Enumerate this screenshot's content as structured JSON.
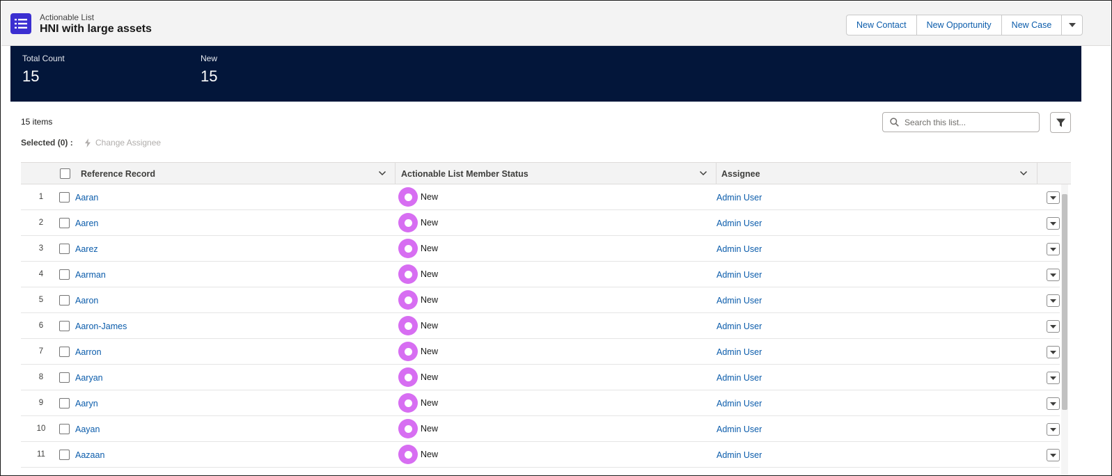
{
  "header": {
    "subtitle": "Actionable List",
    "title": "HNI with large assets",
    "actions": [
      "New Contact",
      "New Opportunity",
      "New Case"
    ]
  },
  "summary": {
    "total_label": "Total Count",
    "total_value": "15",
    "new_label": "New",
    "new_value": "15"
  },
  "toolbar": {
    "items_count": "15 items",
    "selected": "Selected (0) :",
    "change_assignee": "Change Assignee",
    "search_placeholder": "Search this list..."
  },
  "table": {
    "columns": [
      "Reference Record",
      "Actionable List Member Status",
      "Assignee"
    ],
    "rows": [
      {
        "num": "1",
        "ref": "Aaran",
        "status": "New",
        "assignee": "Admin User"
      },
      {
        "num": "2",
        "ref": "Aaren",
        "status": "New",
        "assignee": "Admin User"
      },
      {
        "num": "3",
        "ref": "Aarez",
        "status": "New",
        "assignee": "Admin User"
      },
      {
        "num": "4",
        "ref": "Aarman",
        "status": "New",
        "assignee": "Admin User"
      },
      {
        "num": "5",
        "ref": "Aaron",
        "status": "New",
        "assignee": "Admin User"
      },
      {
        "num": "6",
        "ref": "Aaron-James",
        "status": "New",
        "assignee": "Admin User"
      },
      {
        "num": "7",
        "ref": "Aarron",
        "status": "New",
        "assignee": "Admin User"
      },
      {
        "num": "8",
        "ref": "Aaryan",
        "status": "New",
        "assignee": "Admin User"
      },
      {
        "num": "9",
        "ref": "Aaryn",
        "status": "New",
        "assignee": "Admin User"
      },
      {
        "num": "10",
        "ref": "Aayan",
        "status": "New",
        "assignee": "Admin User"
      },
      {
        "num": "11",
        "ref": "Aazaan",
        "status": "New",
        "assignee": "Admin User"
      }
    ]
  },
  "colors": {
    "brand_icon": "#3b2fd1",
    "summary_bg": "#03163a",
    "link": "#0b5cab",
    "status_new": "#d76ef2"
  }
}
